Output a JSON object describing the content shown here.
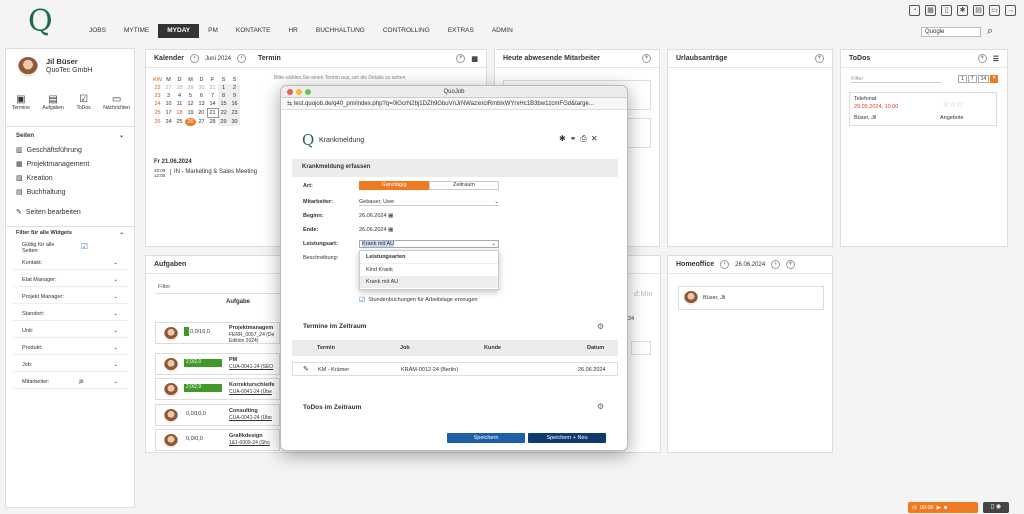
{
  "brand": {
    "logo": "Q",
    "color": "#1d6b45"
  },
  "nav": [
    "JOBS",
    "MYTIME",
    "MYDAY",
    "PM",
    "KONTAKTE",
    "HR",
    "BUCHHALTUNG",
    "CONTROLLING",
    "EXTRAS",
    "ADMIN"
  ],
  "nav_active": "MYDAY",
  "search_select": "Quogle",
  "user": {
    "name": "Jil Büser",
    "company": "QuoTec GmbH"
  },
  "quick": [
    "Termine",
    "Aufgaben",
    "ToDos",
    "Nachrichten"
  ],
  "sidebar": {
    "section": "Seiten",
    "items": [
      "Geschäftsführung",
      "Projektmanagement",
      "Kreation",
      "Buchhaltung"
    ],
    "edit": "Seiten bearbeiten",
    "filter_title": "Filter für alle Widgets",
    "fields": [
      "Gültig für alle Seiten",
      "Kontakt:",
      "Etat Manager:",
      "Projekt Manager:",
      "Standort:",
      "Unit:",
      "Produkt:",
      "Job:",
      "Mitarbeiter:"
    ],
    "mitarbeiter_value": "jb"
  },
  "kalender": {
    "title": "Kalender",
    "month": "Juni 2024",
    "termin_title": "Termin",
    "termin_hint": "Bitte wählen Sie einen Termin aus, um die Details zu sehen",
    "headers": [
      "KW",
      "M",
      "D",
      "M",
      "D",
      "F",
      "S",
      "S"
    ],
    "weeks": [
      [
        "22",
        "27",
        "28",
        "29",
        "30",
        "31",
        "1",
        "2"
      ],
      [
        "23",
        "3",
        "4",
        "5",
        "6",
        "7",
        "8",
        "9"
      ],
      [
        "24",
        "10",
        "11",
        "12",
        "13",
        "14",
        "15",
        "16"
      ],
      [
        "25",
        "17",
        "18",
        "19",
        "20",
        "21",
        "22",
        "23"
      ],
      [
        "26",
        "24",
        "25",
        "26",
        "27",
        "28",
        "29",
        "30"
      ]
    ],
    "selected_date": "Fr 21.06.2024",
    "event_time": "10:00 12:00",
    "event": "IN - Marketing & Sales Meeting"
  },
  "abwesend": {
    "title": "Heute abwesende Mitarbeiter"
  },
  "urlaub": {
    "title": "Urlaubsanträge"
  },
  "todos": {
    "title": "ToDos",
    "filter": "Filter",
    "pages": [
      "1",
      "7",
      "14"
    ],
    "item": {
      "title": "Telefonat",
      "date": "29.05.2024, 10:00",
      "person": "Büser, Jil",
      "tag": "Angebote"
    }
  },
  "aufgaben": {
    "title": "Aufgaben",
    "filter": "Filter",
    "col": "Aufgabe",
    "rows": [
      {
        "val": "0,0/16,0",
        "name": "Projektmanagem",
        "code": "FERR_0057_24 (De",
        "sub": "Edition 2024)"
      },
      {
        "val": "2,0/2,0",
        "name": "PM",
        "code": "CUA-0041-24 (SEO"
      },
      {
        "val": "2,0/2,0",
        "name": "Korrekturschleife",
        "code": "CUA-0041-24 (Übe"
      },
      {
        "val": "0,0/10,0",
        "name": "Consulting",
        "code": "CUA-0041-24 (Übe"
      },
      {
        "val": "0,0/0,0",
        "name": "Grafikdesign",
        "code": "1&1-0009-24 (Sho"
      }
    ]
  },
  "homeoffice": {
    "title": "Homeoffice",
    "date": "26.06.2024",
    "person": "Büser, Jil"
  },
  "modal": {
    "window_title": "QuoJob",
    "url": "test.quojob.de/q40_pm/index.php?q=0lGcrN2bj1DZh9GbuVnJrNWazxnclRmblxWYrxHc1B3bw1zcmFGd&targe...",
    "heading": "Krankmeldung",
    "section": "Krankmeldung erfassen",
    "art_label": "Art:",
    "art_options": [
      "Ganztägig",
      "Zeitraum"
    ],
    "mitarbeiter_label": "Mitarbeiter:",
    "mitarbeiter": "Gebauer, Uwe",
    "beginn_label": "Beginn:",
    "beginn": "26.06.2024",
    "ende_label": "Ende:",
    "ende": "26.06.2024",
    "leistungsart_label": "Leistungsart:",
    "leistungsart": "Krank mit AU",
    "beschreibung_label": "Beschreibung:",
    "dropdown": {
      "header": "Leistungsarten",
      "options": [
        "Kind Krank",
        "Krank mit AU"
      ]
    },
    "checkbox": "Stundenbuchungen für Arbeitstage erzeugen",
    "termine_title": "Termine im Zeitraum",
    "table_headers": [
      "Termin",
      "Job",
      "Kunde",
      "Datum"
    ],
    "table_row": {
      "termin": "KM - Krämer",
      "job": "KRÄM-0012-24 (Berlin)",
      "kunde": "",
      "datum": "26.06.2024"
    },
    "todos_title": "ToDos im Zeitraum",
    "save": "Speichern",
    "save_new": "Speichern + Neu"
  },
  "timer": {
    "time": "00:00"
  },
  "behind_modal": {
    "hint": "d:Min",
    "num": "24"
  }
}
